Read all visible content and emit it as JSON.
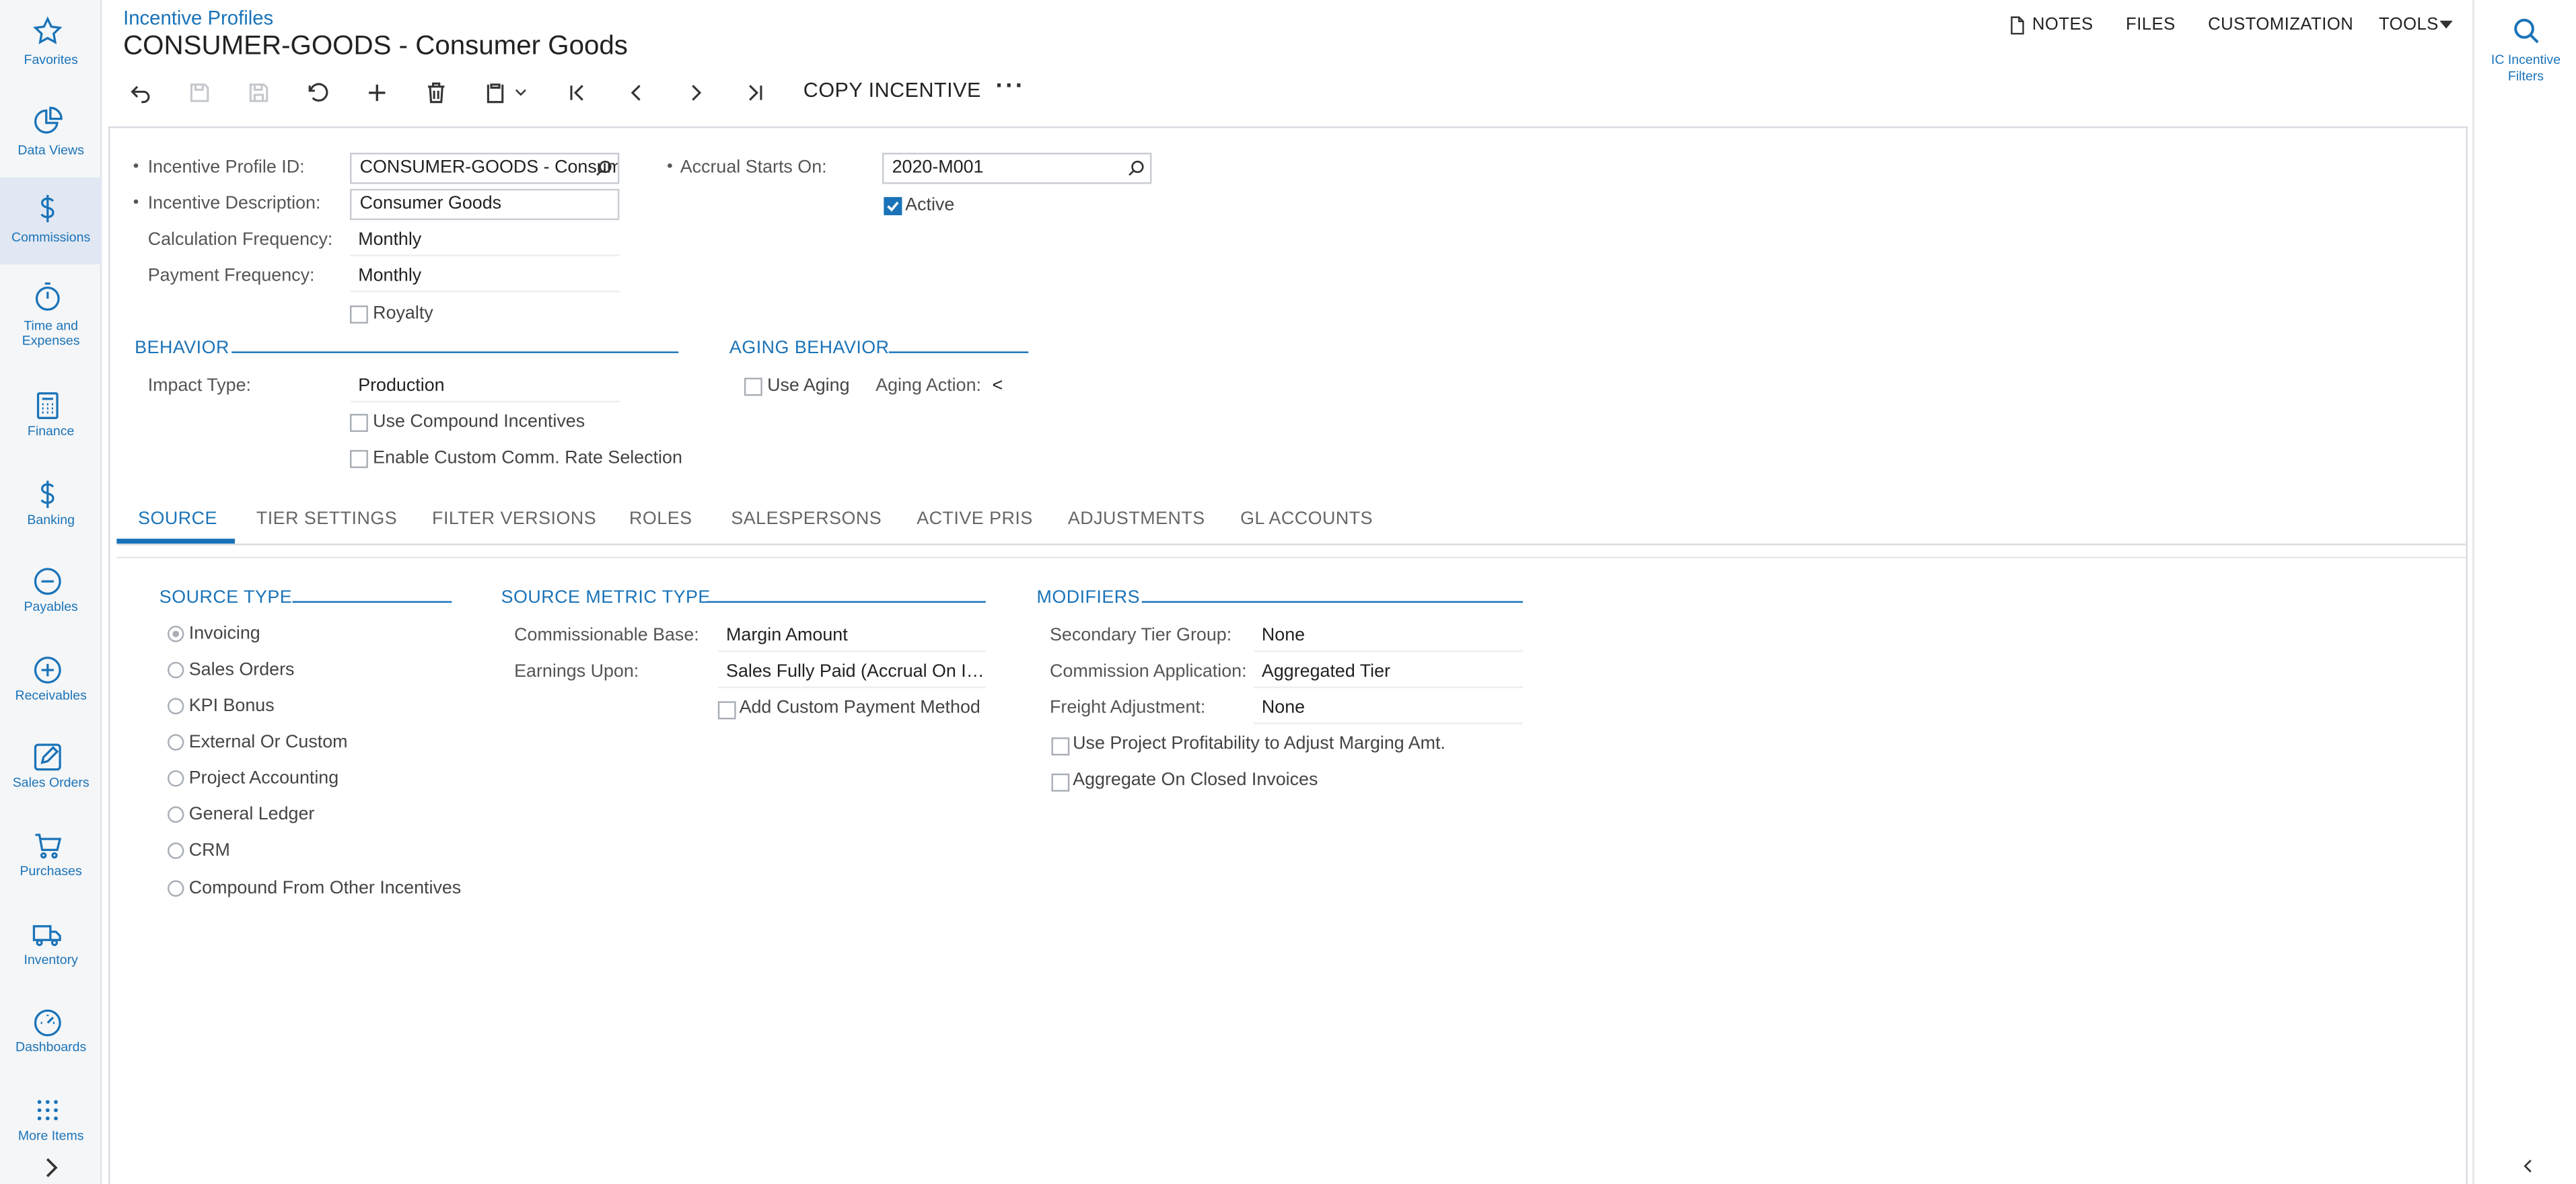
{
  "nav": {
    "items": [
      {
        "label": "Favorites",
        "icon": "star-icon"
      },
      {
        "label": "Data Views",
        "icon": "pie-chart-icon"
      },
      {
        "label": "Commissions",
        "icon": "dollar-icon"
      },
      {
        "label": "Time and Expenses",
        "icon": "stopwatch-icon"
      },
      {
        "label": "Finance",
        "icon": "calculator-icon"
      },
      {
        "label": "Banking",
        "icon": "dollar-icon"
      },
      {
        "label": "Payables",
        "icon": "minus-circle-icon"
      },
      {
        "label": "Receivables",
        "icon": "plus-circle-icon"
      },
      {
        "label": "Sales Orders",
        "icon": "edit-icon"
      },
      {
        "label": "Purchases",
        "icon": "cart-icon"
      },
      {
        "label": "Inventory",
        "icon": "truck-icon"
      },
      {
        "label": "Dashboards",
        "icon": "gauge-icon"
      },
      {
        "label": "More Items",
        "icon": "grid-icon"
      }
    ],
    "active": "Commissions"
  },
  "header": {
    "breadcrumb": "Incentive Profiles",
    "title": "CONSUMER-GOODS - Consumer Goods",
    "links": {
      "notes": "NOTES",
      "files": "FILES",
      "customization": "CUSTOMIZATION",
      "tools": "TOOLS"
    }
  },
  "toolbar": {
    "copy_label": "COPY INCENTIVE",
    "more_label": "···"
  },
  "right_panel": {
    "filter_label_1": "IC Incentive",
    "filter_label_2": "Filters"
  },
  "form": {
    "profile_id_label": "Incentive Profile ID:",
    "profile_id_value": "CONSUMER-GOODS - Consumer Goods",
    "description_label": "Incentive Description:",
    "description_value": "Consumer Goods",
    "calc_freq_label": "Calculation Frequency:",
    "calc_freq_value": "Monthly",
    "pay_freq_label": "Payment Frequency:",
    "pay_freq_value": "Monthly",
    "royalty_label": "Royalty",
    "accrual_label": "Accrual Starts On:",
    "accrual_value": "2020-M001",
    "active_label": "Active",
    "behavior_header": "BEHAVIOR",
    "impact_type_label": "Impact Type:",
    "impact_type_value": "Production",
    "use_compound_label": "Use Compound Incentives",
    "enable_custom_label": "Enable Custom Comm. Rate Selection",
    "aging_header": "AGING BEHAVIOR",
    "use_aging_label": "Use Aging",
    "aging_action_label": "Aging Action:",
    "aging_action_value": "<"
  },
  "tabs": [
    "SOURCE",
    "TIER SETTINGS",
    "FILTER VERSIONS",
    "ROLES",
    "SALESPERSONS",
    "ACTIVE PRIS",
    "ADJUSTMENTS",
    "GL ACCOUNTS"
  ],
  "source": {
    "source_type_header": "SOURCE TYPE",
    "source_types": [
      "Invoicing",
      "Sales Orders",
      "KPI Bonus",
      "External Or Custom",
      "Project Accounting",
      "General Ledger",
      "CRM",
      "Compound From Other Incentives"
    ],
    "selected_source_type": "Invoicing",
    "metric_header": "SOURCE METRIC TYPE",
    "commissionable_base_label": "Commissionable Base:",
    "commissionable_base_value": "Margin Amount",
    "earnings_upon_label": "Earnings Upon:",
    "earnings_upon_value": "Sales Fully Paid (Accrual On Invoice)",
    "add_custom_payment_label": "Add Custom Payment Method",
    "modifiers_header": "MODIFIERS",
    "secondary_tier_label": "Secondary Tier Group:",
    "secondary_tier_value": "None",
    "commission_app_label": "Commission Application:",
    "commission_app_value": "Aggregated Tier",
    "freight_adj_label": "Freight Adjustment:",
    "freight_adj_value": "None",
    "use_project_label": "Use Project Profitability to Adjust Marging Amt.",
    "aggregate_closed_label": "Aggregate On Closed Invoices"
  }
}
